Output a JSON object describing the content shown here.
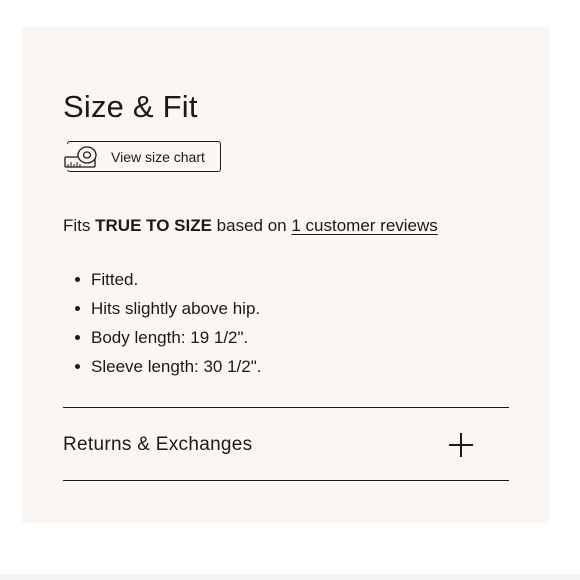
{
  "section": {
    "title": "Size & Fit"
  },
  "size_chart": {
    "label": "View size chart",
    "icon": "measuring-tape-icon"
  },
  "fit": {
    "prefix": "Fits",
    "rating": "TRUE TO SIZE",
    "middle": "based on",
    "reviews_link": "1 customer reviews"
  },
  "details": [
    "Fitted.",
    "Hits slightly above hip.",
    "Body length: 19 1/2\".",
    "Sleeve length: 30 1/2\"."
  ],
  "accordion": {
    "title": "Returns & Exchanges",
    "icon": "plus-icon"
  },
  "colors": {
    "panel_background": "#f9f6f3",
    "text": "#1a1a1a"
  }
}
